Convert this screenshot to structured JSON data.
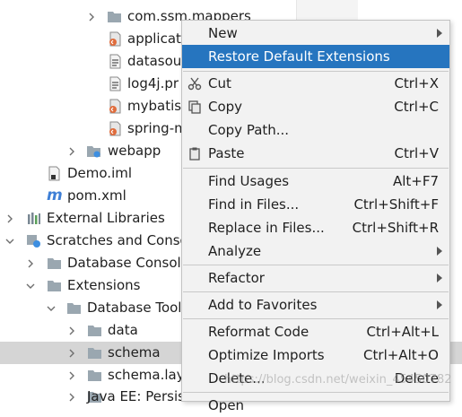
{
  "tree": {
    "items": [
      {
        "label": "com.ssm.mappers"
      },
      {
        "label": "applicat"
      },
      {
        "label": "datasou"
      },
      {
        "label": "log4j.pr"
      },
      {
        "label": "mybatis-"
      },
      {
        "label": "spring-m"
      },
      {
        "label": "webapp"
      },
      {
        "label": "Demo.iml"
      },
      {
        "label": "pom.xml"
      },
      {
        "label": "External Libraries"
      },
      {
        "label": "Scratches and Conso"
      },
      {
        "label": "Database Console"
      },
      {
        "label": "Extensions"
      },
      {
        "label": "Database Tool"
      },
      {
        "label": "data"
      },
      {
        "label": "schema"
      },
      {
        "label": "schema.layo"
      },
      {
        "label": "Java EE: Persist"
      }
    ]
  },
  "menu": {
    "items": [
      {
        "label": "New",
        "shortcut": ""
      },
      {
        "label": "Restore Default Extensions",
        "shortcut": ""
      },
      {
        "label": "Cut",
        "shortcut": "Ctrl+X"
      },
      {
        "label": "Copy",
        "shortcut": "Ctrl+C"
      },
      {
        "label": "Copy Path...",
        "shortcut": ""
      },
      {
        "label": "Paste",
        "shortcut": "Ctrl+V"
      },
      {
        "label": "Find Usages",
        "shortcut": "Alt+F7"
      },
      {
        "label": "Find in Files...",
        "shortcut": "Ctrl+Shift+F"
      },
      {
        "label": "Replace in Files...",
        "shortcut": "Ctrl+Shift+R"
      },
      {
        "label": "Analyze",
        "shortcut": ""
      },
      {
        "label": "Refactor",
        "shortcut": ""
      },
      {
        "label": "Add to Favorites",
        "shortcut": ""
      },
      {
        "label": "Reformat Code",
        "shortcut": "Ctrl+Alt+L"
      },
      {
        "label": "Optimize Imports",
        "shortcut": "Ctrl+Alt+O"
      },
      {
        "label": "Delete...",
        "shortcut": "Delete"
      },
      {
        "label": "Open",
        "shortcut": ""
      }
    ]
  },
  "watermark": "https://blog.csdn.net/weixin_45450782",
  "colors": {
    "highlight": "#2675bf",
    "menu_bg": "#f2f2f2",
    "selected_row": "#d5d5d5",
    "folder": "#9aa7b0"
  }
}
